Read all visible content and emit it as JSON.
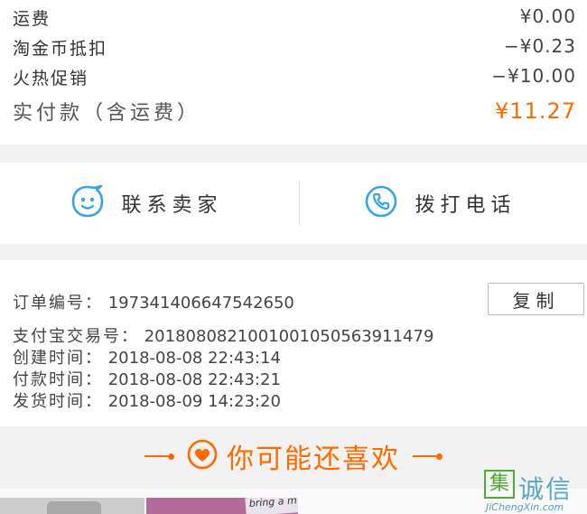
{
  "summary": {
    "rows": [
      {
        "label": "运费",
        "value": "¥0.00"
      },
      {
        "label": "淘金币抵扣",
        "value": "−¥0.23"
      },
      {
        "label": "火热促销",
        "value": "−¥10.00"
      }
    ],
    "total_label": "实付款（含运费）",
    "total_value": "¥11.27"
  },
  "contact": {
    "seller_label": "联系卖家",
    "phone_label": "拨打电话"
  },
  "order_info": {
    "order_no_label": "订单编号：",
    "order_no": "197341406647542650",
    "copy_label": "复制",
    "alipay_label": "支付宝交易号：",
    "alipay_no": "2018080821001001050563911479",
    "created_label": "创建时间：",
    "created": "2018-08-08 22:43:14",
    "paid_label": "付款时间：",
    "paid": "2018-08-08 22:43:21",
    "shipped_label": "发货时间：",
    "shipped": "2018-08-09 14:23:20"
  },
  "recommend": {
    "title": "你可能还喜欢"
  },
  "products": {
    "poster_text": "bring a m"
  },
  "watermark": {
    "brand": "诚信",
    "logo_char": "集",
    "url": "JiChengXin.com"
  },
  "colors": {
    "accent": "#ff6a00",
    "icon_blue": "#3aa3e3"
  },
  "icons": [
    "chat-bubble-icon",
    "phone-icon",
    "heart-icon"
  ]
}
